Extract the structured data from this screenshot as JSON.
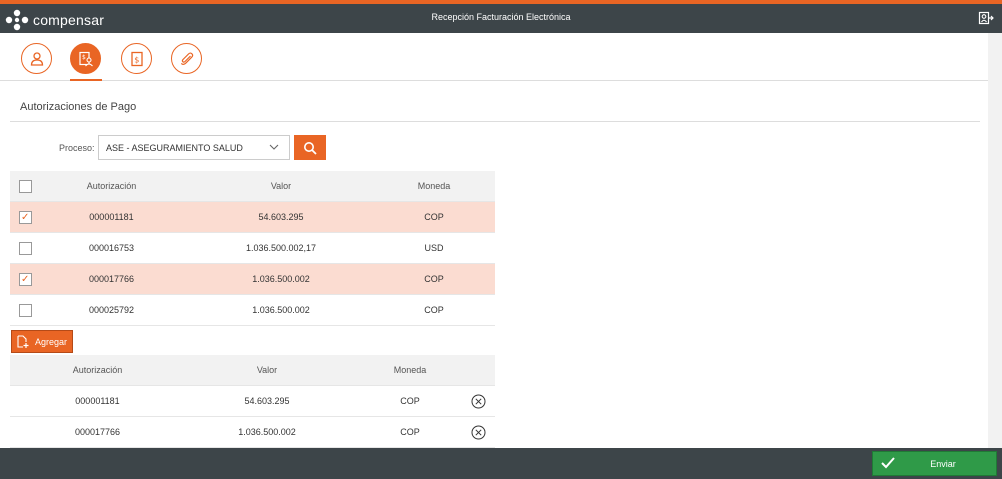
{
  "app": {
    "brand": "compensar",
    "title": "Recepción Facturación Electrónica"
  },
  "colors": {
    "accent": "#e96524",
    "header_bg": "#3d4549",
    "selected_row": "#fbdcd1",
    "send": "#2f9a48"
  },
  "steps": [
    {
      "icon": "user-icon",
      "active": false
    },
    {
      "icon": "payment-auth-icon",
      "active": true
    },
    {
      "icon": "invoice-dollar-icon",
      "active": false
    },
    {
      "icon": "paperclip-icon",
      "active": false
    }
  ],
  "section": {
    "title": "Autorizaciones de Pago"
  },
  "filter": {
    "label": "Proceso:",
    "selected": "ASE - ASEGURAMIENTO SALUD"
  },
  "available": {
    "columns": [
      "Autorización",
      "Valor",
      "Moneda"
    ],
    "rows": [
      {
        "auth": "000001181",
        "value": "54.603.295",
        "currency": "COP",
        "checked": true
      },
      {
        "auth": "000016753",
        "value": "1.036.500.002,17",
        "currency": "USD",
        "checked": false
      },
      {
        "auth": "000017766",
        "value": "1.036.500.002",
        "currency": "COP",
        "checked": true
      },
      {
        "auth": "000025792",
        "value": "1.036.500.002",
        "currency": "COP",
        "checked": false
      }
    ]
  },
  "add_button": {
    "label": "Agregar"
  },
  "added": {
    "columns": [
      "Autorización",
      "Valor",
      "Moneda"
    ],
    "rows": [
      {
        "auth": "000001181",
        "value": "54.603.295",
        "currency": "COP"
      },
      {
        "auth": "000017766",
        "value": "1.036.500.002",
        "currency": "COP"
      }
    ]
  },
  "footer": {
    "send_label": "Enviar"
  }
}
